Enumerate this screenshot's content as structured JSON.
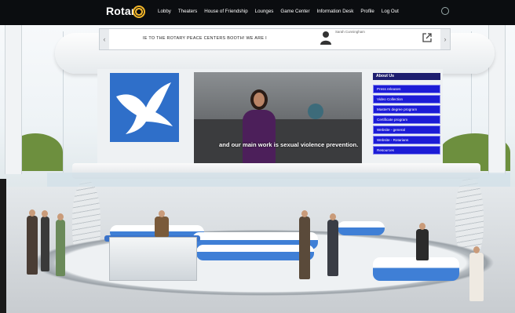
{
  "nav": {
    "brand": "Rotary",
    "items": [
      "Lobby",
      "Theaters",
      "House of Friendship",
      "Lounges",
      "Game Center",
      "Information Desk",
      "Profile",
      "Log Out"
    ]
  },
  "ticker": {
    "text": "IE TO THE ROTARY PEACE CENTERS BOOTH! WE ARE I",
    "speaker": "Sarah Cunningham"
  },
  "video": {
    "subtitle": "and our main work is sexual violence prevention."
  },
  "menu": {
    "title": "About Us",
    "items": [
      "Press releases",
      "Video Collection",
      "Master's degree program",
      "Certificate program",
      "Website - general",
      "Website - Rotarians",
      "Resources"
    ]
  },
  "colors": {
    "nav_bg": "#0b0d10",
    "rotary_gold": "#f0b429",
    "menu_blue": "#1c1cd6",
    "dove_blue": "#2f6fc9"
  }
}
